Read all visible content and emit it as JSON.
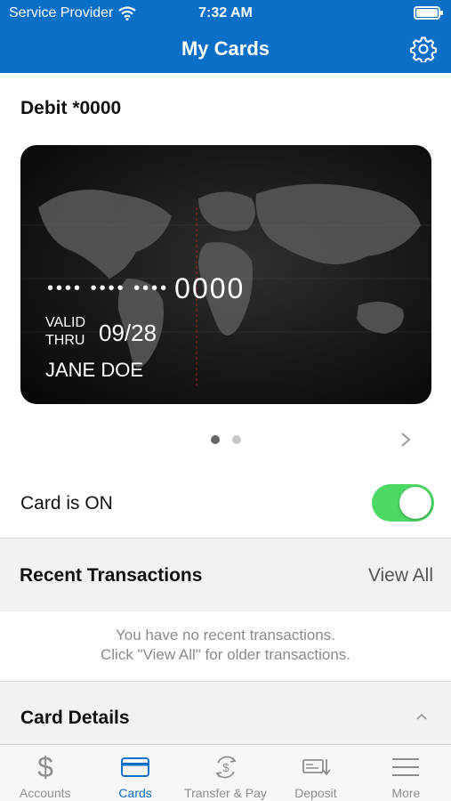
{
  "status_bar": {
    "carrier": "Service Provider",
    "time": "7:32 AM"
  },
  "nav": {
    "title": "My Cards"
  },
  "card": {
    "title": "Debit *0000",
    "masked_number": "•••• •••• ••••",
    "last4": "0000",
    "valid_line1": "VALID",
    "valid_line2": "THRU",
    "expiry": "09/28",
    "holder": "JANE DOE"
  },
  "pager": {
    "count": 2,
    "active": 1
  },
  "toggle": {
    "label": "Card is ON",
    "on": true,
    "on_color": "#4cd964"
  },
  "recent": {
    "title": "Recent Transactions",
    "view_all": "View All",
    "empty_line1": "You have no recent transactions.",
    "empty_line2": "Click \"View All\" for older transactions."
  },
  "details": {
    "title": "Card Details"
  },
  "tabs": [
    {
      "label": "Accounts",
      "icon": "dollar-icon",
      "active": false
    },
    {
      "label": "Cards",
      "icon": "card-icon",
      "active": true
    },
    {
      "label": "Transfer & Pay",
      "icon": "transfer-icon",
      "active": false
    },
    {
      "label": "Deposit",
      "icon": "check-deposit-icon",
      "active": false
    },
    {
      "label": "More",
      "icon": "menu-icon",
      "active": false
    }
  ],
  "colors": {
    "brand": "#0a6fc7",
    "tab_inactive": "#8e8e8e",
    "section_bg": "#f2f2f2"
  }
}
